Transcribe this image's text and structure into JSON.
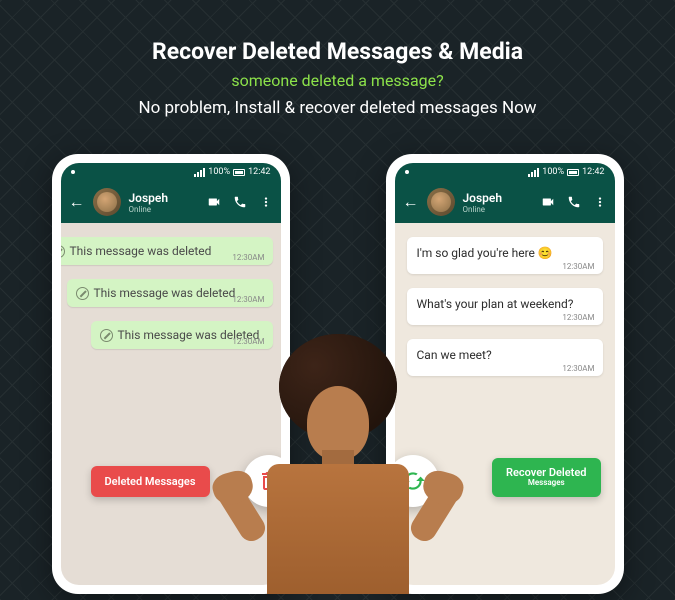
{
  "header": {
    "title": "Recover Deleted Messages & Media",
    "subtitle": "someone deleted a message?",
    "tagline": "No problem, Install & recover deleted messages Now"
  },
  "statusBar": {
    "battery": "100%",
    "time": "12:42"
  },
  "contact": {
    "name": "Jospeh",
    "status": "Online"
  },
  "leftPhone": {
    "messages": [
      {
        "text": "This message was deleted",
        "time": "12:30AM"
      },
      {
        "text": "This message was deleted",
        "time": "12:30AM"
      },
      {
        "text": "This message was deleted",
        "time": "12:30AM"
      }
    ],
    "button": "Deleted Messages"
  },
  "rightPhone": {
    "messages": [
      {
        "text": "I'm so glad you're here 😊",
        "time": "12:30AM"
      },
      {
        "text": "What's your plan at weekend?",
        "time": "12:30AM"
      },
      {
        "text": "Can we meet?",
        "time": "12:30AM"
      }
    ],
    "buttonLine1": "Recover Deleted",
    "buttonLine2": "Messages"
  }
}
